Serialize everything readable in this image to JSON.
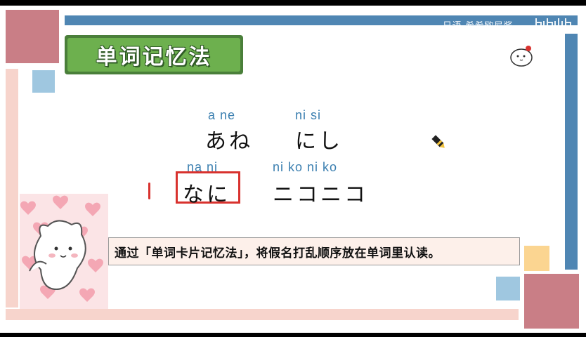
{
  "watermark": {
    "text": "日语-希希欧尼酱",
    "logo_icon": "bilibili-logo-icon"
  },
  "title": {
    "text": "单词记忆法"
  },
  "words": [
    {
      "romaji": "a  ne",
      "kana": "あね"
    },
    {
      "romaji": "ni  si",
      "kana": "にし"
    },
    {
      "romaji": "na ni",
      "kana": "なに"
    },
    {
      "romaji": "ni  ko  ni  ko",
      "kana": "ニコニコ"
    }
  ],
  "caption": {
    "text": "通过「单词卡片记忆法」，将假名打乱顺序放在单词里认读。"
  },
  "icons": {
    "pen": "highlighter-pen-icon",
    "mascot_small": "cat-mascot-icon",
    "mascot_large": "cat-mascot-illustration"
  },
  "colors": {
    "title_bg": "#6db04e",
    "romaji": "#3b7fb0",
    "highlight_box": "#d8322e",
    "accent_blue": "#4f86b3",
    "accent_rose": "#c97e86",
    "accent_pink": "#f7d4cc"
  }
}
